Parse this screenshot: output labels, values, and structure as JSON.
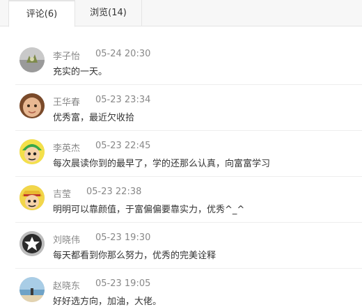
{
  "tabs": [
    {
      "label": "评论(6)",
      "active": true
    },
    {
      "label": "浏览(14)",
      "active": false
    }
  ],
  "comments": [
    {
      "name": "李子怡",
      "time": "05-24 20:30",
      "text": "充实的一天。",
      "avatar": "plant-avatar"
    },
    {
      "name": "王华春",
      "time": "05-23 23:34",
      "text": "优秀富，最近欠收拾",
      "avatar": "baby-avatar"
    },
    {
      "name": "李英杰",
      "time": "05-23 22:45",
      "text": "每次晨读你到的最早了，学的还那么认真，向富富学习",
      "avatar": "cartoon-green-avatar"
    },
    {
      "name": "吉莹",
      "time": "05-23 22:38",
      "text": "明明可以靠颜值，于富偏偏要靠实力，优秀^_^",
      "avatar": "cartoon-hat-avatar"
    },
    {
      "name": "刘晓伟",
      "time": "05-23 19:30",
      "text": "每天都看到你那么努力，优秀的完美诠释",
      "avatar": "star-avatar"
    },
    {
      "name": "赵晓东",
      "time": "05-23 19:05",
      "text": "好好选方向，加油，大佬。",
      "avatar": "beach-avatar"
    }
  ]
}
